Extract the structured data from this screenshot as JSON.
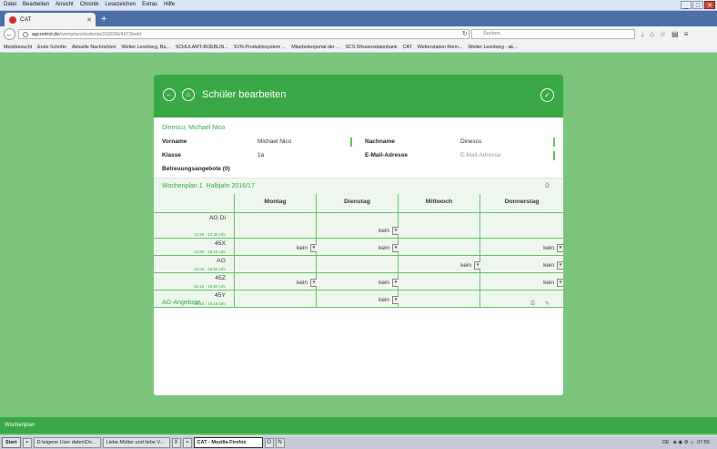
{
  "browser": {
    "menu": [
      "Datei",
      "Bearbeiten",
      "Ansicht",
      "Chronik",
      "Lesezeichen",
      "Extras",
      "Hilfe"
    ],
    "tab_title": "CAT",
    "url_host": "agcontrol.de",
    "url_path": "/wemplan/students/202036/4973/edit",
    "search_placeholder": "Suchen",
    "bookmarks": [
      "Meistbesucht",
      "Erste Schritte",
      "Aktuelle Nachrichten",
      "Wetter Leonberg, Ba...",
      "SCHULAMT-BOEBLIN...",
      "SVN-Produktivsystem ...",
      "Mitarbeiterportal der ...",
      "SCS Wissensdatenbank",
      "CAT",
      "Wetterstation Renn...",
      "Wetter Leonberg - ak..."
    ]
  },
  "card": {
    "title": "Schüler bearbeiten",
    "student_name": "Dinescu, Michael Nico",
    "fields": {
      "vorname_label": "Vorname",
      "vorname_value": "Michael Nico",
      "nachname_label": "Nachname",
      "nachname_value": "Dinescu",
      "klasse_label": "Klasse",
      "klasse_value": "1a",
      "email_label": "E-Mail-Adresse",
      "email_placeholder": "E-Mail-Adresse",
      "betreuung_label": "Betreuungsangebote (0)"
    },
    "wochenplan_title": "Wochenplan 1. Halbjahr 2016/17",
    "days": [
      "Montag",
      "Dienstag",
      "Mittwoch",
      "Donnerstag"
    ],
    "rows": [
      {
        "title": "AG Di",
        "time": "11:55 - 12:30 Uhr",
        "cells": [
          "",
          "kein",
          "",
          ""
        ]
      },
      {
        "title": "45X",
        "time": "14:35 - 15:15 Uhr",
        "cells": [
          "kein",
          "kein",
          "",
          "kein"
        ]
      },
      {
        "title": "AG",
        "time": "15:00 - 16:00 Uhr",
        "cells": [
          "",
          "",
          "kein",
          "kein"
        ]
      },
      {
        "title": "45Z",
        "time": "15:15 - 16:00 Uhr",
        "cells": [
          "kein",
          "kein",
          "",
          "kein"
        ]
      },
      {
        "title": "45Y",
        "time": "15:15 - 16:15 Uhr",
        "cells": [
          "",
          "kein",
          "",
          ""
        ]
      }
    ],
    "ag_title": "AG-Angebote"
  },
  "footer": {
    "label": "Wochenplan"
  },
  "taskbar": {
    "start": "Start",
    "items": [
      "D:\\eigene User daten\\Do...",
      "Liebe Mütter und liebe V...",
      "CAT - Mozilla Firefox"
    ],
    "lang": "DE",
    "clock": "07:55"
  }
}
